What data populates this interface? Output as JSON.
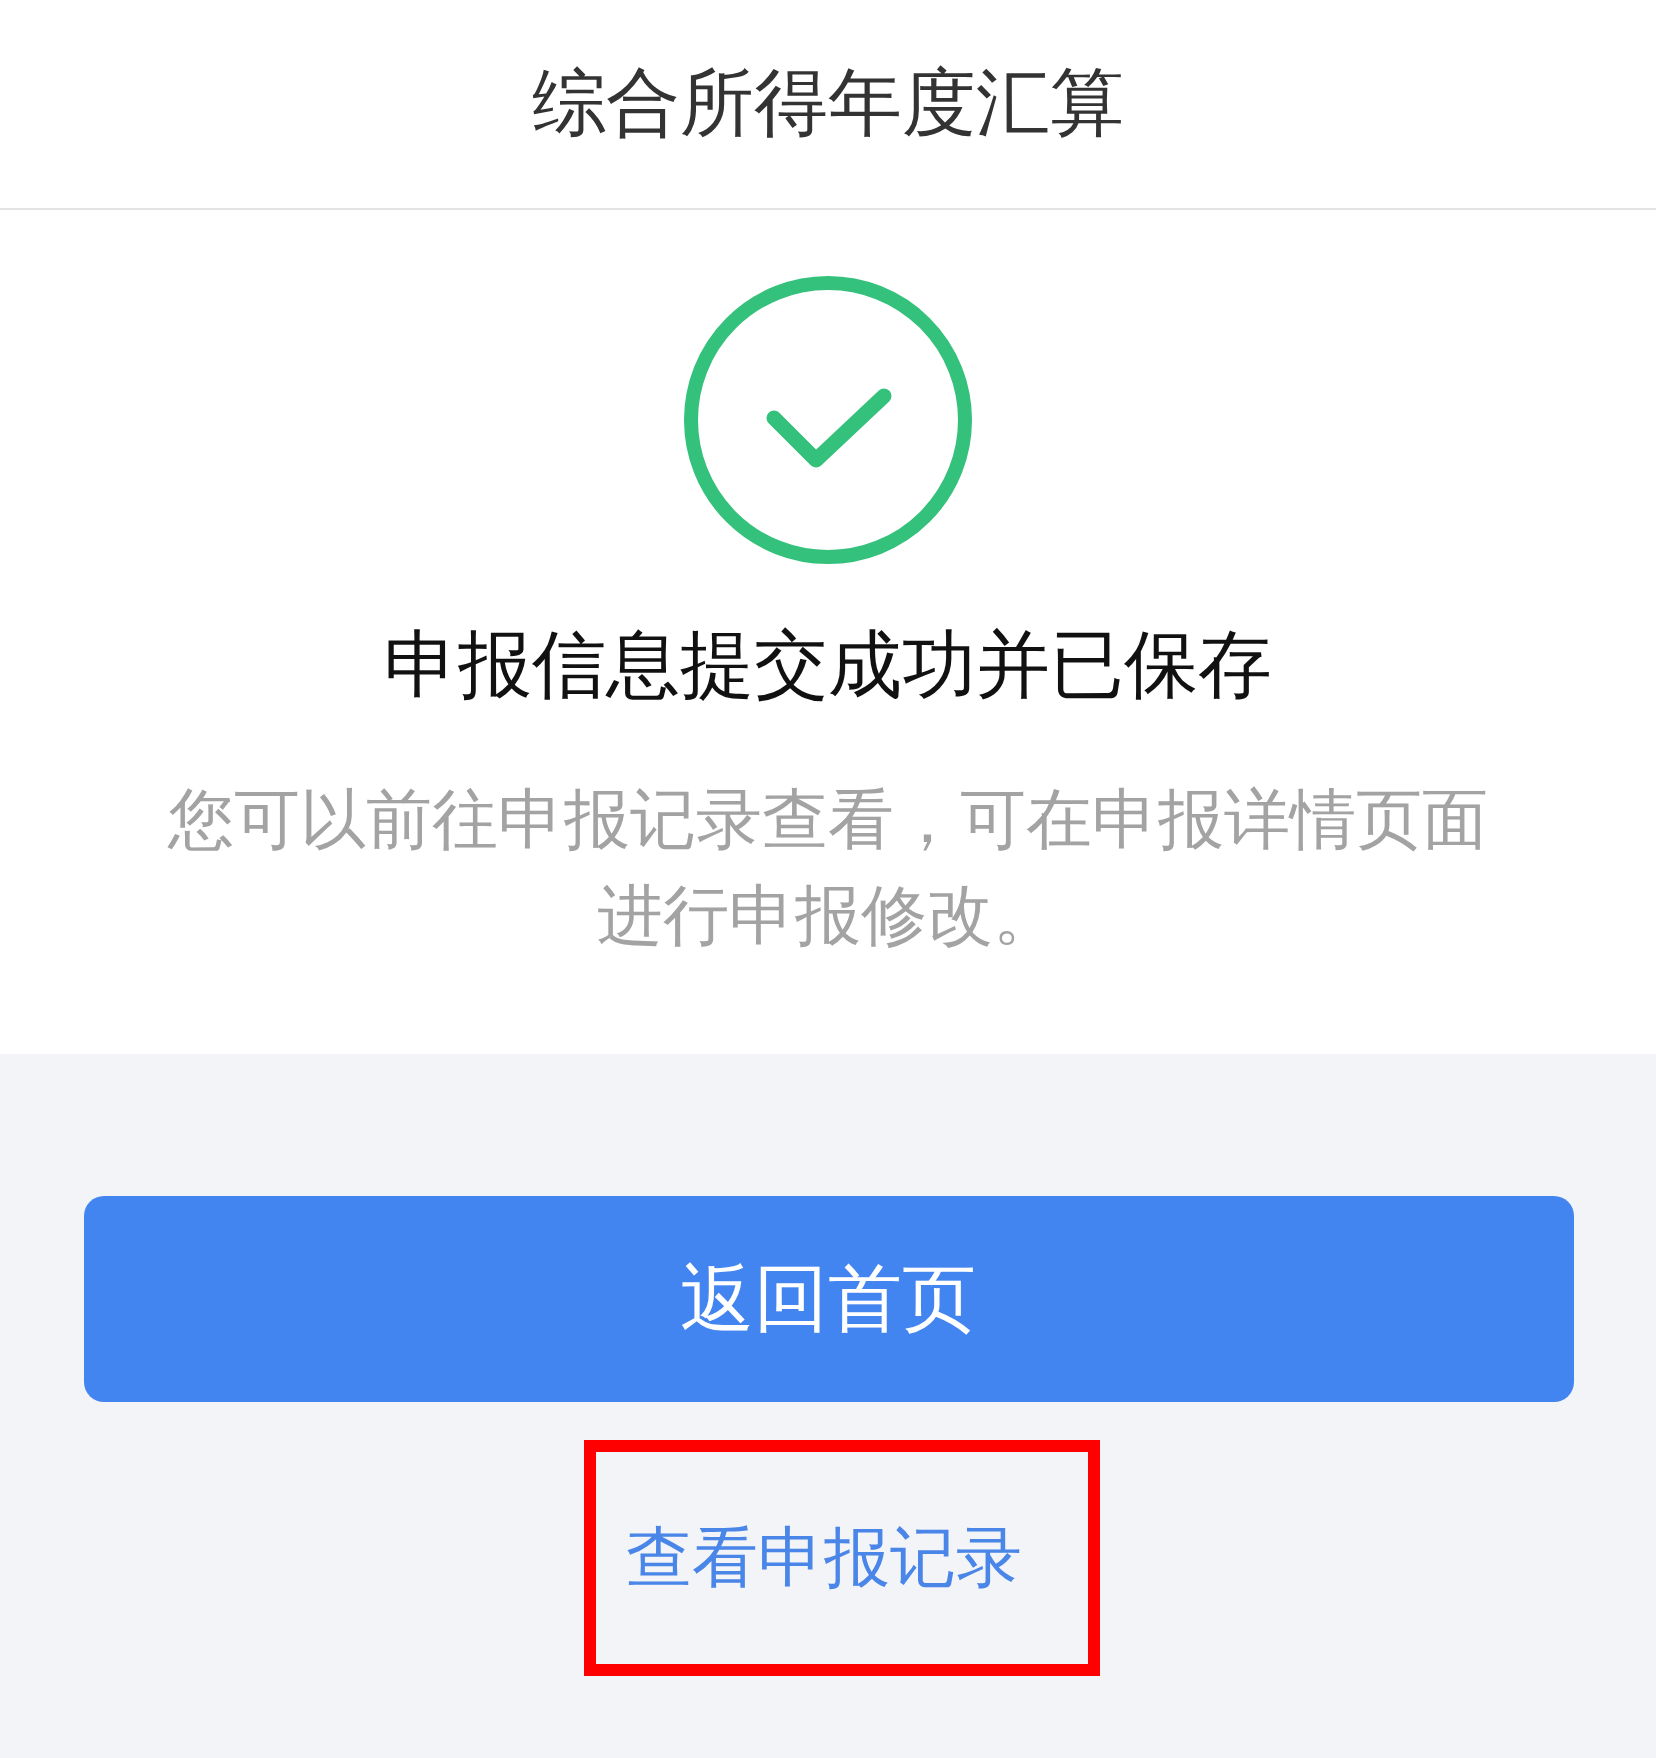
{
  "header": {
    "title": "综合所得年度汇算"
  },
  "result": {
    "success": true,
    "title": "申报信息提交成功并已保存",
    "description": "您可以前往申报记录查看，可在申报详情页面进行申报修改。"
  },
  "actions": {
    "primary_button": "返回首页",
    "link": {
      "label": "查看申报记录",
      "highlighted": true
    }
  }
}
